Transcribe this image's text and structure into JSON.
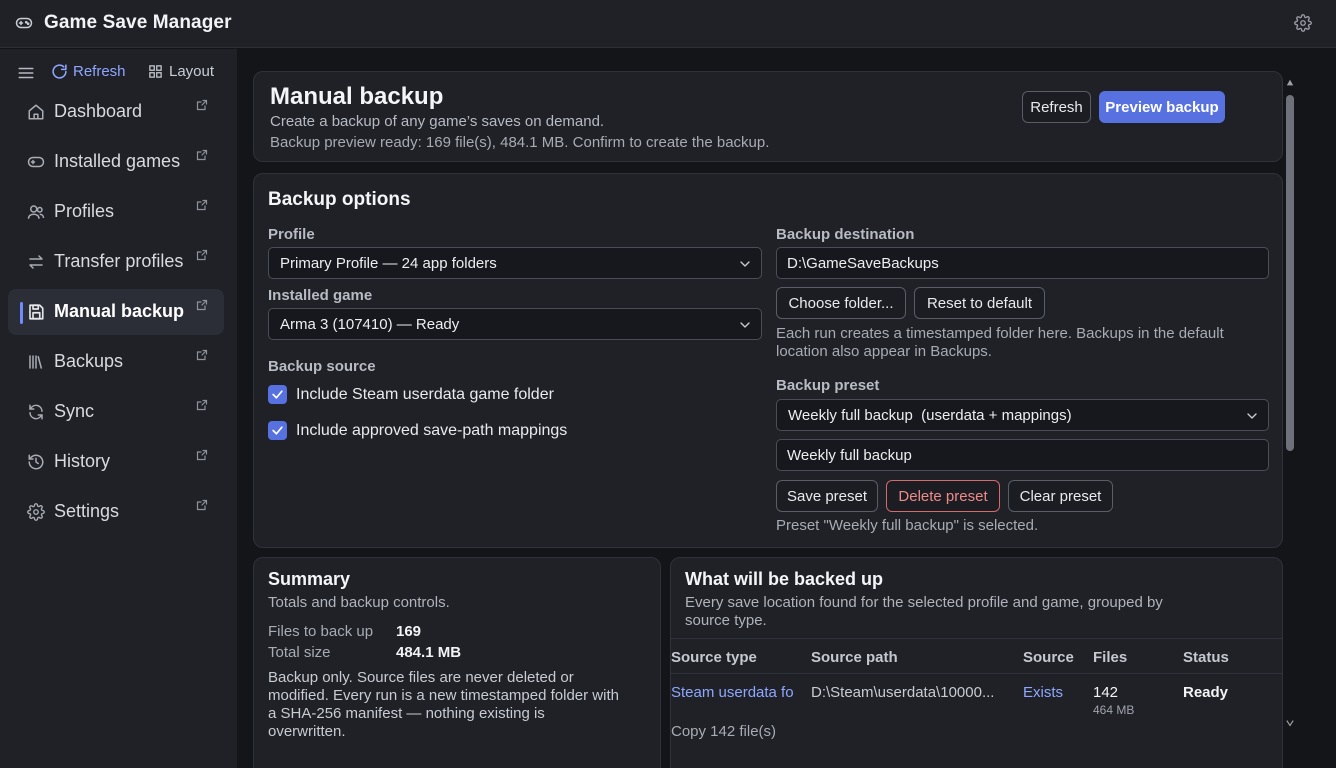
{
  "app": {
    "title": "Game Save Manager"
  },
  "sidebar": {
    "refresh_label": "Refresh",
    "layout_label": "Layout",
    "items": [
      {
        "label": "Dashboard",
        "icon": "home-icon"
      },
      {
        "label": "Installed games",
        "icon": "gamepad-icon"
      },
      {
        "label": "Profiles",
        "icon": "users-icon"
      },
      {
        "label": "Transfer profiles",
        "icon": "transfer-icon"
      },
      {
        "label": "Manual backup",
        "icon": "save-icon",
        "active": true
      },
      {
        "label": "Backups",
        "icon": "library-icon"
      },
      {
        "label": "Sync",
        "icon": "sync-icon"
      },
      {
        "label": "History",
        "icon": "history-icon"
      },
      {
        "label": "Settings",
        "icon": "gear-icon"
      }
    ]
  },
  "header": {
    "title": "Manual backup",
    "subtitle": "Create a backup of any game’s saves on demand.",
    "status": "Backup preview ready: 169 file(s), 484.1 MB. Confirm to create the backup.",
    "refresh_label": "Refresh",
    "preview_label": "Preview backup"
  },
  "options": {
    "title": "Backup options",
    "profile_label": "Profile",
    "profile_value": "Primary Profile — 24 app folders",
    "game_label": "Installed game",
    "game_value": "Arma 3 (107410) — Ready",
    "source_label": "Backup source",
    "source_checks": [
      {
        "label": "Include Steam userdata game folder",
        "checked": true
      },
      {
        "label": "Include approved save-path mappings",
        "checked": true
      }
    ],
    "destination_label": "Backup destination",
    "destination_value": "D:\\GameSaveBackups",
    "choose_folder_label": "Choose folder...",
    "reset_default_label": "Reset to default",
    "destination_help_1": "Each run creates a timestamped folder here. Backups in the default",
    "destination_help_2": "location also appear in Backups.",
    "preset_label": "Backup preset",
    "preset_select_value": "Weekly full backup  (userdata + mappings)",
    "preset_name_value": "Weekly full backup",
    "save_preset_label": "Save preset",
    "delete_preset_label": "Delete preset",
    "clear_preset_label": "Clear preset",
    "preset_status": "Preset \"Weekly full backup\" is selected."
  },
  "summary": {
    "title": "Summary",
    "subtitle": "Totals and backup controls.",
    "files_label": "Files to back up",
    "files_value": "169",
    "size_label": "Total size",
    "size_value": "484.1 MB",
    "note_1": "Backup only. Source files are never deleted or",
    "note_2": "modified. Every run is a new timestamped folder with",
    "note_3": "a SHA-256 manifest — nothing existing is",
    "note_4": "overwritten."
  },
  "backed_up": {
    "title": "What will be backed up",
    "subtitle_1": "Every save location found for the selected profile and game, grouped by",
    "subtitle_2": "source type.",
    "columns": [
      "Source type",
      "Source path",
      "Source",
      "Files",
      "Status"
    ],
    "rows": [
      {
        "source_type": "Steam userdata fo",
        "source_path": "D:\\Steam\\userdata\\10000...",
        "source": "Exists",
        "files": "142",
        "files_size": "464 MB",
        "status": "Ready",
        "detail": "Copy 142 file(s)"
      }
    ]
  },
  "colors": {
    "accent": "#5772e0",
    "link": "#8ea7ff",
    "danger": "#ee8a8a",
    "background": "#141519",
    "panel": "#1f2127"
  }
}
